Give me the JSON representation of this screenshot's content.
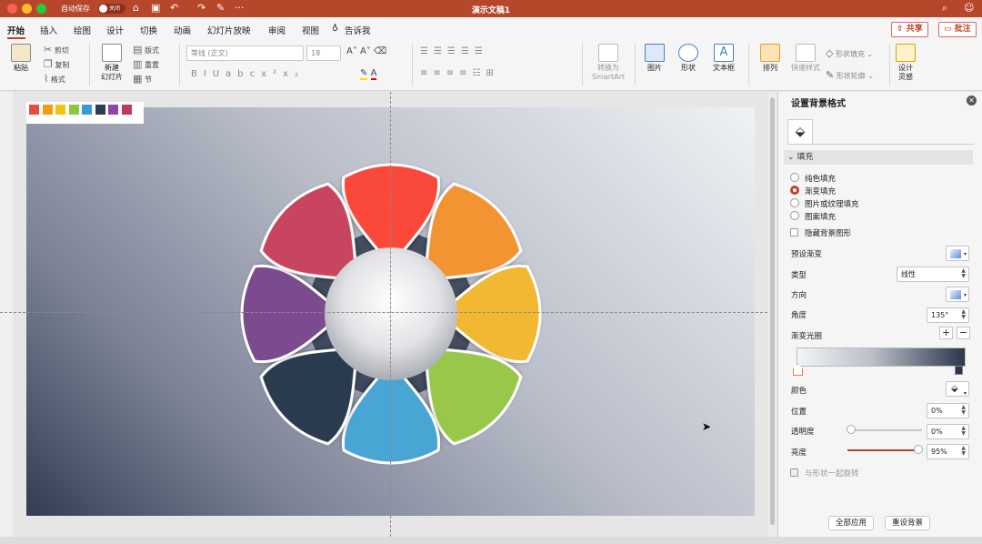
{
  "window": {
    "autosave_label": "自动保存",
    "autosave_state": "关闭",
    "title": "演示文稿1"
  },
  "tabs": [
    "开始",
    "插入",
    "绘图",
    "设计",
    "切换",
    "动画",
    "幻灯片放映",
    "审阅",
    "视图"
  ],
  "tell_me": "告诉我",
  "share_label": "共享",
  "comments_label": "批注",
  "ribbon": {
    "paste": "粘贴",
    "cut": "剪切",
    "copy": "复制",
    "format": "格式",
    "new_slide_1": "新建",
    "new_slide_2": "幻灯片",
    "layout": "版式",
    "reset": "重置",
    "section": "节",
    "font_name": "等线 (正文)",
    "font_size": "18",
    "smartart_1": "转换为",
    "smartart_2": "SmartArt",
    "picture": "图片",
    "shape": "形状",
    "textbox": "文本框",
    "arrange": "排列",
    "quick_styles": "快速样式",
    "shape_fill": "形状填充",
    "shape_outline": "形状轮廓",
    "designer_1": "设计",
    "designer_2": "灵感"
  },
  "swatches": [
    "#e84c3d",
    "#f39c12",
    "#f1c40f",
    "#8dc63f",
    "#3b9bd4",
    "#2c3e50",
    "#8e44ad",
    "#c0395a"
  ],
  "petals": [
    {
      "name": "red",
      "color": "#fa4a3a"
    },
    {
      "name": "orange",
      "color": "#f29430"
    },
    {
      "name": "yellow",
      "color": "#f3b831"
    },
    {
      "name": "green",
      "color": "#98c74a"
    },
    {
      "name": "blue",
      "color": "#48a5d3"
    },
    {
      "name": "navy",
      "color": "#2a3a50"
    },
    {
      "name": "purple",
      "color": "#7b4b8f"
    },
    {
      "name": "rose",
      "color": "#c9455e"
    }
  ],
  "panel": {
    "title": "设置背景格式",
    "fill_section": "填充",
    "options": [
      "纯色填充",
      "渐变填充",
      "图片或纹理填充",
      "图案填充"
    ],
    "selected_option": "渐变填充",
    "hide_bg": "隐藏背景图形",
    "preset_label": "预设渐变",
    "type_label": "类型",
    "type_value": "线性",
    "direction_label": "方向",
    "angle_label": "角度",
    "angle_value": "135°",
    "stops_label": "渐变光圈",
    "color_label": "颜色",
    "position_label": "位置",
    "position_value": "0%",
    "transparency_label": "透明度",
    "transparency_value": "0%",
    "transparency_level": 0,
    "brightness_label": "亮度",
    "brightness_value": "95%",
    "brightness_level": 0.95,
    "rotate_with_shape": "与形状一起旋转",
    "apply_all": "全部应用",
    "reset_bg": "重设背景"
  },
  "colors": {
    "accent": "#b7472a",
    "gradient_start": "#f2f4f7",
    "gradient_end": "#2c374b"
  }
}
